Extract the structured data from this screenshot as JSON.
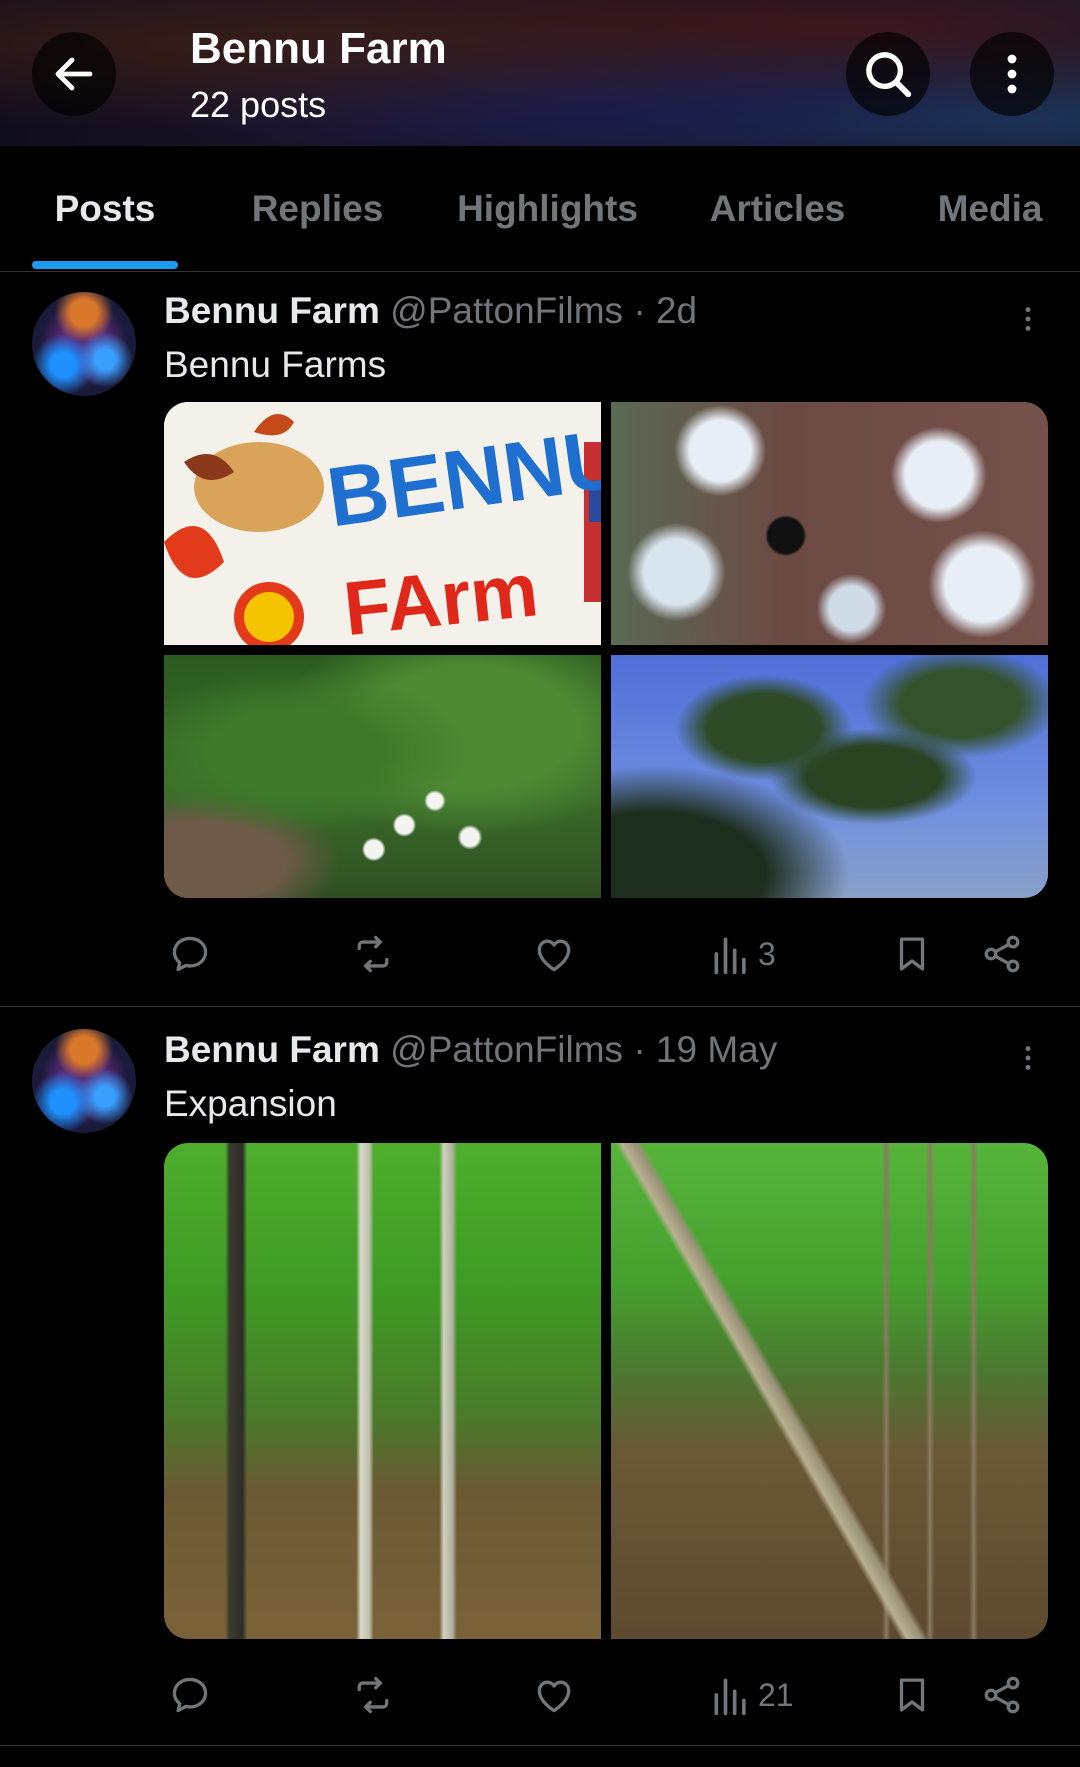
{
  "header": {
    "title": "Bennu Farm",
    "post_count": "22 posts"
  },
  "tabs": [
    {
      "label": "Posts",
      "active": true
    },
    {
      "label": "Replies",
      "active": false
    },
    {
      "label": "Highlights",
      "active": false
    },
    {
      "label": "Articles",
      "active": false
    },
    {
      "label": "Media",
      "active": false
    }
  ],
  "posts": [
    {
      "author": "Bennu Farm",
      "meta": "@PattonFilms · 2d",
      "text": "Bennu Farms",
      "images": [
        "bennu-farm-sign-image",
        "bee-on-flowers-image",
        "green-plants-image",
        "plant-against-sky-image"
      ],
      "views": "3"
    },
    {
      "author": "Bennu Farm",
      "meta": "@PattonFilms · 19 May",
      "text": "Expansion",
      "images": [
        "forest-floor-image",
        "forest-clearing-fence-image"
      ],
      "views": "21"
    }
  ],
  "colors": {
    "accent": "#1d9bf0",
    "muted": "#71767b",
    "text": "#e7e9ea",
    "background": "#000000"
  }
}
